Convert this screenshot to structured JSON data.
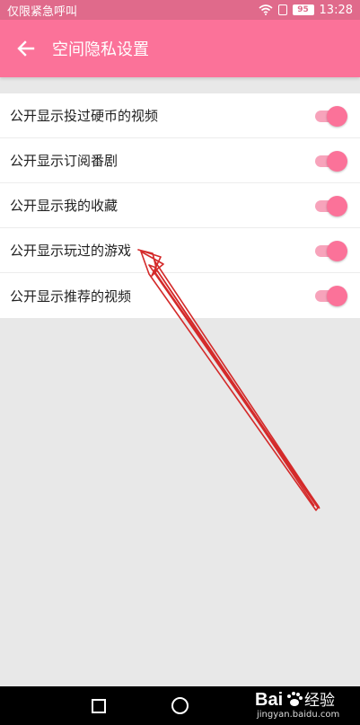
{
  "status_bar": {
    "carrier_text": "仅限紧急呼叫",
    "battery": "95",
    "time": "13:28",
    "icons": [
      "wifi-icon",
      "sim-icon",
      "battery-icon"
    ]
  },
  "app_bar": {
    "back_icon": "arrow-left-icon",
    "title": "空间隐私设置",
    "color": "#fb7299"
  },
  "settings": {
    "items": [
      {
        "label": "公开显示投过硬币的视频",
        "enabled": true
      },
      {
        "label": "公开显示订阅番剧",
        "enabled": true
      },
      {
        "label": "公开显示我的收藏",
        "enabled": true
      },
      {
        "label": "公开显示玩过的游戏",
        "enabled": true
      },
      {
        "label": "公开显示推荐的视频",
        "enabled": true
      }
    ]
  },
  "annotation": {
    "type": "red-arrow",
    "color": "#d42a2a"
  },
  "nav_bar": {
    "buttons": [
      "recent-apps-icon",
      "home-icon"
    ]
  },
  "watermark": {
    "logo_text": "Bai",
    "logo_text2": "经验",
    "sub_text": "jingyan.baidu.com"
  },
  "colors": {
    "accent": "#fb7299",
    "status_bar": "#e06a8b",
    "background": "#e8e8e8"
  }
}
